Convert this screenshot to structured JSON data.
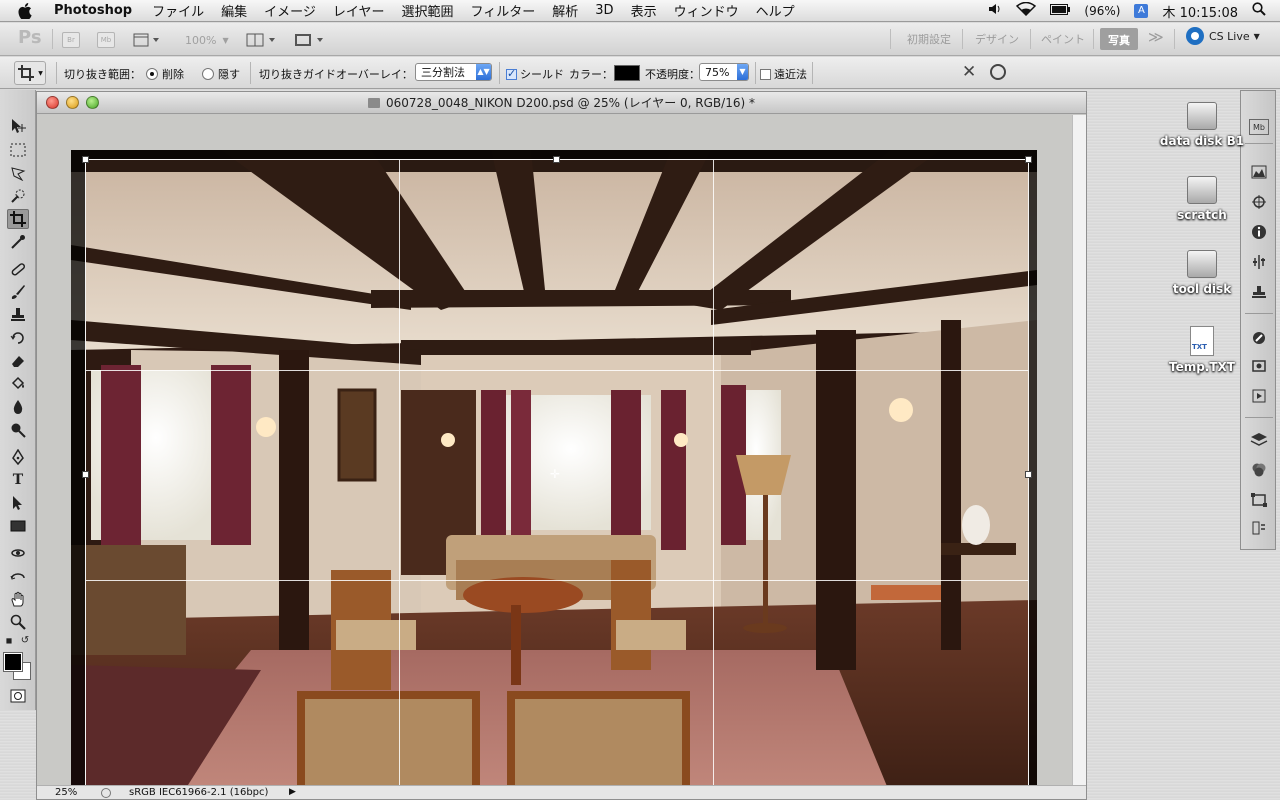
{
  "menubar": {
    "app_name": "Photoshop",
    "items": [
      "ファイル",
      "編集",
      "イメージ",
      "レイヤー",
      "選択範囲",
      "フィルター",
      "解析",
      "3D",
      "表示",
      "ウィンドウ",
      "ヘルプ"
    ],
    "battery": "(96%)",
    "input_mode": "A",
    "clock": "木 10:15:08"
  },
  "appbar": {
    "ps_logo": "Ps",
    "br_label": "Br",
    "mb_label": "Mb",
    "zoom": "100%",
    "workspaces": [
      "初期設定",
      "デザイン",
      "ペイント",
      "写真"
    ],
    "active_workspace": "写真",
    "more": "≫",
    "cs_live": "CS Live"
  },
  "options": {
    "crop_area_label": "切り抜き範囲：",
    "delete_label": "削除",
    "hide_label": "隠す",
    "overlay_label": "切り抜きガイドオーバーレイ：",
    "overlay_value": "三分割法",
    "shield_label": "シールド",
    "color_label": "カラー：",
    "opacity_label": "不透明度：",
    "opacity_value": "75%",
    "perspective_label": "遠近法",
    "shield_checked": true,
    "perspective_checked": false
  },
  "document": {
    "title": "060728_0048_NIKON D200.psd @ 25% (レイヤー 0, RGB/16) *",
    "zoom": "25%",
    "profile": "sRGB IEC61966-2.1 (16bpc)"
  },
  "desktop": {
    "icons": [
      "data disk B1",
      "scratch",
      "tool disk",
      "Temp.TXT"
    ]
  },
  "colors": {
    "foreground": "#000000",
    "background": "#ffffff",
    "shield": "#000000"
  }
}
